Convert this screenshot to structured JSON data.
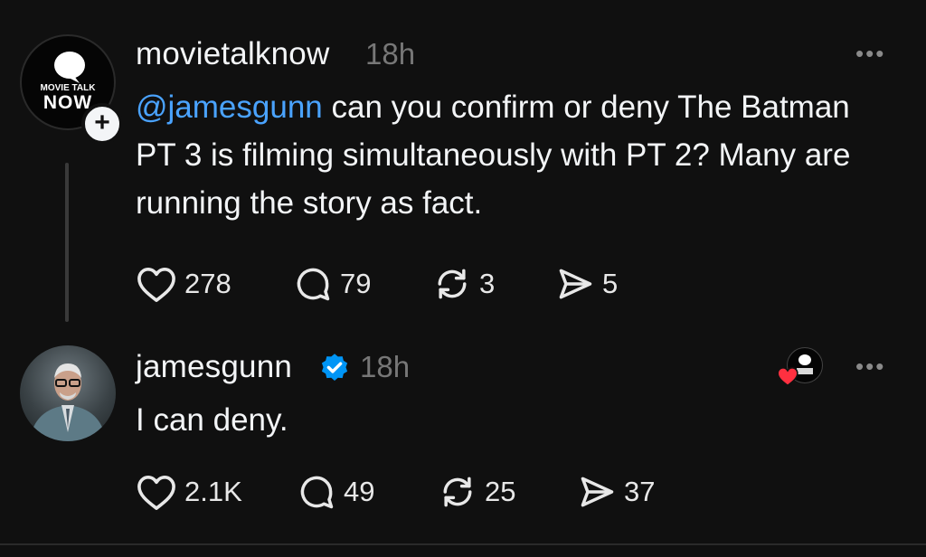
{
  "post1": {
    "avatar_logo_line1": "MOVIE TALK",
    "avatar_logo_line2": "NOW",
    "username": "movietalknow",
    "time": "18h",
    "mention": "@jamesgunn",
    "text": " can you confirm or deny The Batman PT 3 is filming simultaneously with PT 2? Many are running the story as fact.",
    "likes": "278",
    "replies": "79",
    "reposts": "3",
    "shares": "5",
    "follow_icon": "plus-icon"
  },
  "post2": {
    "username": "jamesgunn",
    "verified_icon": "verified-badge-icon",
    "time": "18h",
    "text": "I can deny.",
    "likes": "2.1K",
    "replies": "49",
    "reposts": "25",
    "shares": "37",
    "liked_by_author_icon": "heart-icon"
  },
  "colors": {
    "background": "#101010",
    "mention": "#4aa3ff",
    "verified": "#0095f6",
    "heart": "#ff3040"
  }
}
